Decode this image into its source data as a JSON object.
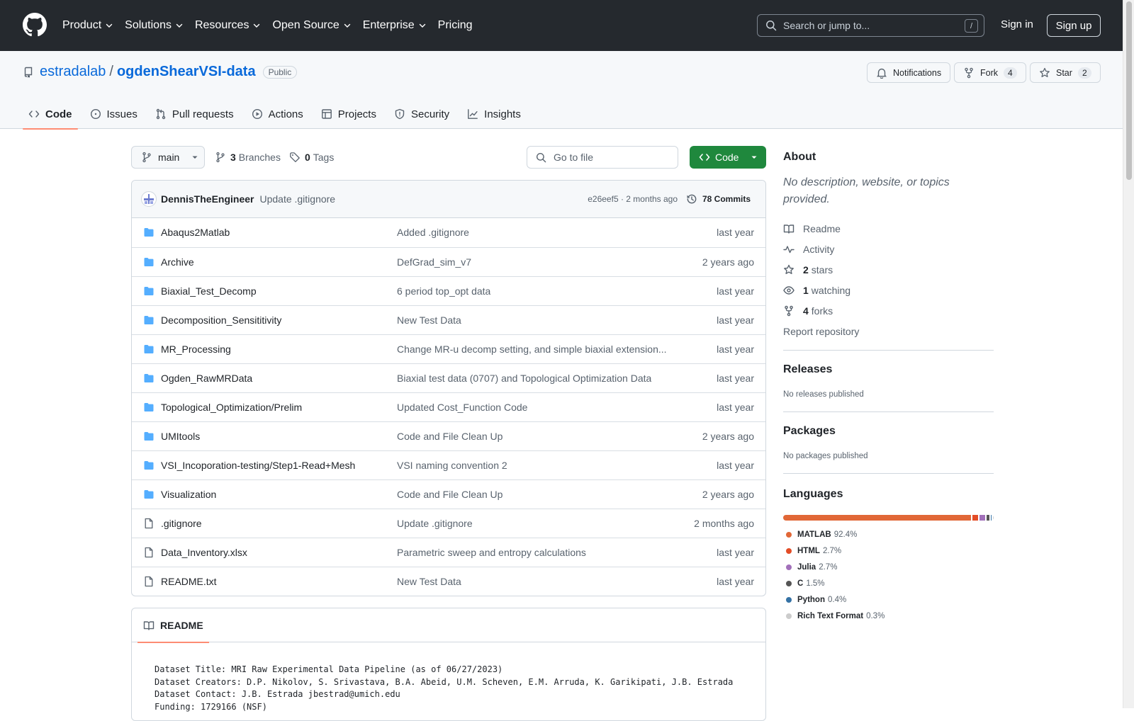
{
  "header": {
    "nav": [
      {
        "label": "Product",
        "chevron": true
      },
      {
        "label": "Solutions",
        "chevron": true
      },
      {
        "label": "Resources",
        "chevron": true
      },
      {
        "label": "Open Source",
        "chevron": true
      },
      {
        "label": "Enterprise",
        "chevron": true
      },
      {
        "label": "Pricing",
        "chevron": false
      }
    ],
    "search_placeholder": "Search or jump to...",
    "search_key": "/",
    "sign_in": "Sign in",
    "sign_up": "Sign up"
  },
  "repo": {
    "owner": "estradalab",
    "separator": "/",
    "name": "ogdenShearVSI-data",
    "visibility": "Public",
    "notifications_label": "Notifications",
    "fork_label": "Fork",
    "fork_count": "4",
    "star_label": "Star",
    "star_count": "2",
    "tabs": [
      {
        "label": "Code",
        "icon": "code-icon",
        "active": true
      },
      {
        "label": "Issues",
        "icon": "issue-icon",
        "active": false
      },
      {
        "label": "Pull requests",
        "icon": "pull-request-icon",
        "active": false
      },
      {
        "label": "Actions",
        "icon": "play-icon",
        "active": false
      },
      {
        "label": "Projects",
        "icon": "table-icon",
        "active": false
      },
      {
        "label": "Security",
        "icon": "shield-icon",
        "active": false
      },
      {
        "label": "Insights",
        "icon": "graph-icon",
        "active": false
      }
    ]
  },
  "file_nav": {
    "branch": "main",
    "branches_count": "3",
    "branches_label": "Branches",
    "tags_count": "0",
    "tags_label": "Tags",
    "goto_placeholder": "Go to file",
    "code_button": "Code"
  },
  "latest_commit": {
    "author": "DennisTheEngineer",
    "message": "Update .gitignore",
    "meta": "e26eef5 · 2 months ago",
    "commits_label": "78 Commits"
  },
  "files": [
    {
      "type": "dir",
      "name": "Abaqus2Matlab",
      "message": "Added .gitignore",
      "age": "last year"
    },
    {
      "type": "dir",
      "name": "Archive",
      "message": "DefGrad_sim_v7",
      "age": "2 years ago"
    },
    {
      "type": "dir",
      "name": "Biaxial_Test_Decomp",
      "message": "6 period top_opt data",
      "age": "last year"
    },
    {
      "type": "dir",
      "name": "Decomposition_Sensititivity",
      "message": "New Test Data",
      "age": "last year"
    },
    {
      "type": "dir",
      "name": "MR_Processing",
      "message": "Change MR-u decomp setting, and simple biaxial extension...",
      "age": "last year"
    },
    {
      "type": "dir",
      "name": "Ogden_RawMRData",
      "message": "Biaxial test data (0707) and Topological Optimization Data",
      "age": "last year"
    },
    {
      "type": "dir",
      "name": "Topological_Optimization/Prelim",
      "message": "Updated Cost_Function Code",
      "age": "last year"
    },
    {
      "type": "dir",
      "name": "UMItools",
      "message": "Code and File Clean Up",
      "age": "2 years ago"
    },
    {
      "type": "dir",
      "name": "VSI_Incoporation-testing/Step1-Read+Mesh",
      "message": "VSI naming convention 2",
      "age": "last year"
    },
    {
      "type": "dir",
      "name": "Visualization",
      "message": "Code and File Clean Up",
      "age": "2 years ago"
    },
    {
      "type": "file",
      "name": ".gitignore",
      "message": "Update .gitignore",
      "age": "2 months ago"
    },
    {
      "type": "file",
      "name": "Data_Inventory.xlsx",
      "message": "Parametric sweep and entropy calculations",
      "age": "last year"
    },
    {
      "type": "file",
      "name": "README.txt",
      "message": "New Test Data",
      "age": "last year"
    }
  ],
  "readme": {
    "tab_label": "README",
    "lines": [
      "Dataset Title: MRI Raw Experimental Data Pipeline (as of 06/27/2023)",
      "Dataset Creators: D.P. Nikolov, S. Srivastava, B.A. Abeid, U.M. Scheven, E.M. Arruda, K. Garikipati, J.B. Estrada",
      "Dataset Contact: J.B. Estrada jbestrad@umich.edu",
      "Funding: 1729166 (NSF)"
    ]
  },
  "sidebar": {
    "about_title": "About",
    "description": "No description, website, or topics provided.",
    "links": [
      {
        "icon": "book-icon",
        "count": "",
        "label": "Readme"
      },
      {
        "icon": "pulse-icon",
        "count": "",
        "label": "Activity"
      },
      {
        "icon": "star-icon",
        "count": "2",
        "label": "stars"
      },
      {
        "icon": "eye-icon",
        "count": "1",
        "label": "watching"
      },
      {
        "icon": "fork-icon",
        "count": "4",
        "label": "forks"
      }
    ],
    "report": "Report repository",
    "releases_title": "Releases",
    "releases_text": "No releases published",
    "packages_title": "Packages",
    "packages_text": "No packages published",
    "languages_title": "Languages",
    "languages": [
      {
        "name": "MATLAB",
        "percent": "92.4%",
        "value": 92.4,
        "color": "#e16737"
      },
      {
        "name": "HTML",
        "percent": "2.7%",
        "value": 2.7,
        "color": "#e34c26"
      },
      {
        "name": "Julia",
        "percent": "2.7%",
        "value": 2.7,
        "color": "#a270ba"
      },
      {
        "name": "C",
        "percent": "1.5%",
        "value": 1.5,
        "color": "#555555"
      },
      {
        "name": "Python",
        "percent": "0.4%",
        "value": 0.4,
        "color": "#3572a5"
      },
      {
        "name": "Rich Text Format",
        "percent": "0.3%",
        "value": 0.3,
        "color": "#cccccc"
      }
    ]
  },
  "colors": {
    "header_bg": "#25292e",
    "link": "#0969da",
    "primary_green": "#1f883d",
    "folder": "#54aeff",
    "tab_underline": "#fd8c73"
  }
}
